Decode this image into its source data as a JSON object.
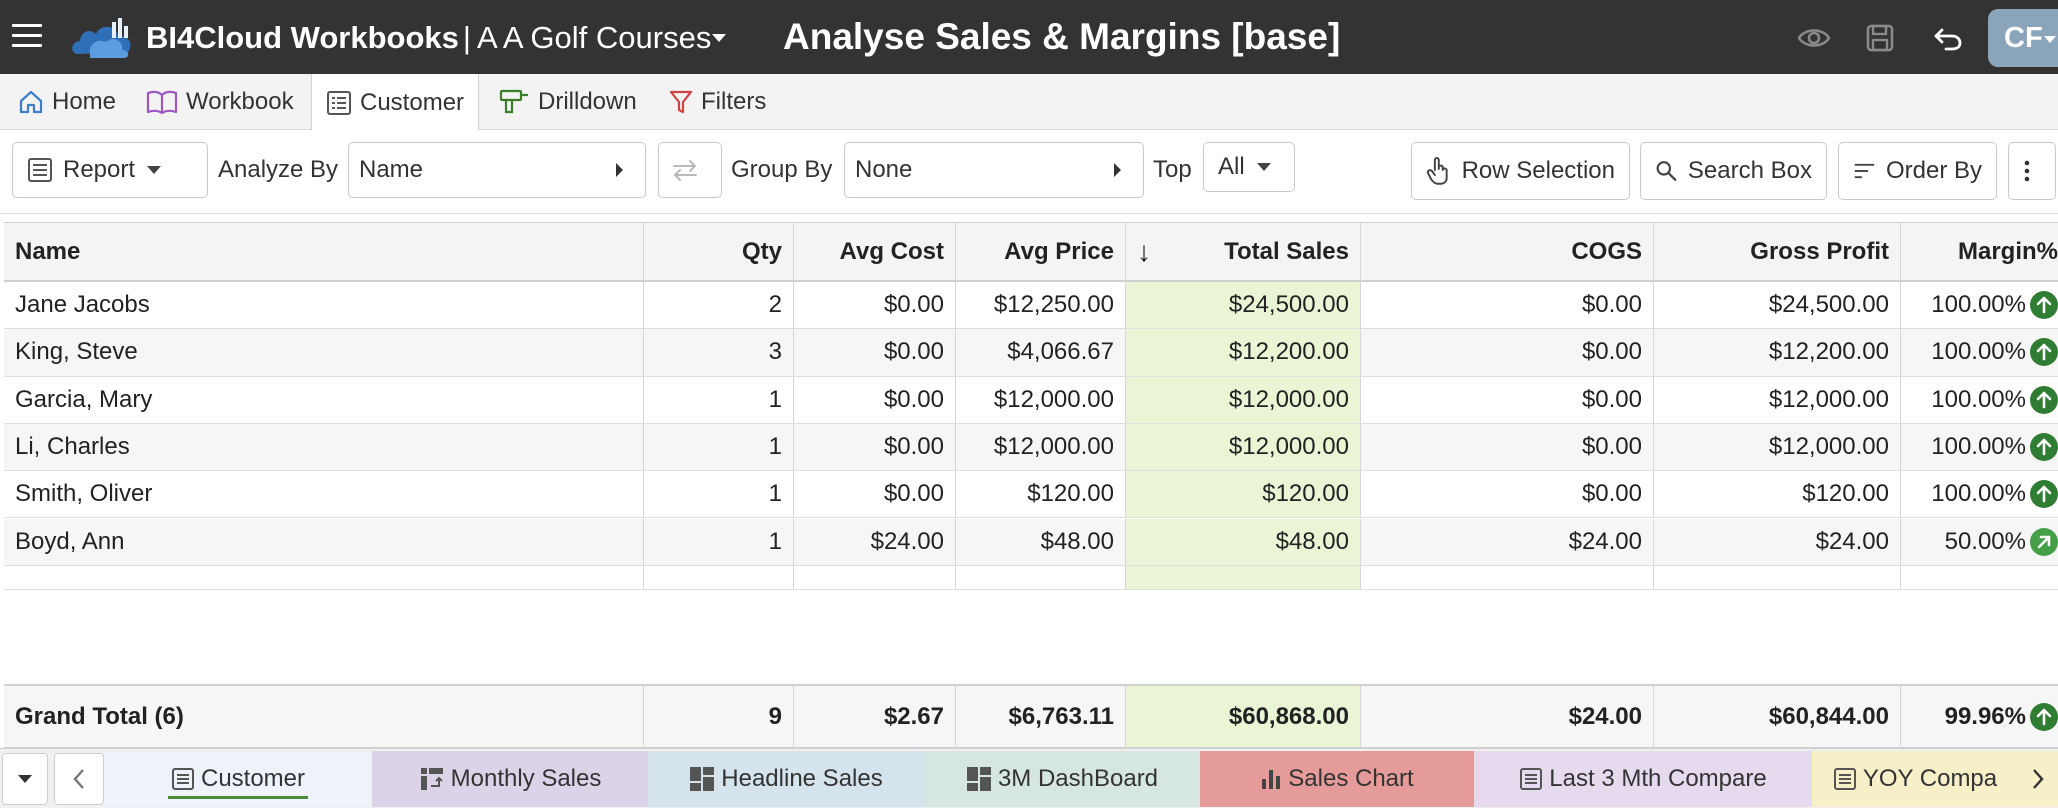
{
  "app": {
    "brand": "BI4Cloud Workbooks",
    "separator": "|",
    "company": "A A Golf Courses",
    "page_title": "Analyse Sales & Margins [base]",
    "user_initials": "CF"
  },
  "nav_tabs": [
    {
      "label": "Home",
      "icon": "home-icon"
    },
    {
      "label": "Workbook",
      "icon": "book-icon"
    },
    {
      "label": "Customer",
      "icon": "list-icon",
      "active": true
    },
    {
      "label": "Drilldown",
      "icon": "drill-icon"
    },
    {
      "label": "Filters",
      "icon": "filter-icon"
    }
  ],
  "toolbar": {
    "report_label": "Report",
    "analyze_by_label": "Analyze By",
    "analyze_by_value": "Name",
    "group_by_label": "Group By",
    "group_by_value": "None",
    "top_label": "Top",
    "top_value": "All",
    "row_selection_label": "Row Selection",
    "search_box_label": "Search Box",
    "order_by_label": "Order By"
  },
  "table": {
    "columns": [
      "Name",
      "Qty",
      "Avg Cost",
      "Avg Price",
      "Total Sales",
      "COGS",
      "Gross Profit",
      "Margin%"
    ],
    "sort_indicator": "↓",
    "rows": [
      {
        "name": "Jane Jacobs",
        "qty": "2",
        "avg_cost": "$0.00",
        "avg_price": "$12,250.00",
        "total_sales": "$24,500.00",
        "cogs": "$0.00",
        "gross_profit": "$24,500.00",
        "margin": "100.00%",
        "trend": "up"
      },
      {
        "name": "King, Steve",
        "qty": "3",
        "avg_cost": "$0.00",
        "avg_price": "$4,066.67",
        "total_sales": "$12,200.00",
        "cogs": "$0.00",
        "gross_profit": "$12,200.00",
        "margin": "100.00%",
        "trend": "up"
      },
      {
        "name": "Garcia, Mary",
        "qty": "1",
        "avg_cost": "$0.00",
        "avg_price": "$12,000.00",
        "total_sales": "$12,000.00",
        "cogs": "$0.00",
        "gross_profit": "$12,000.00",
        "margin": "100.00%",
        "trend": "up"
      },
      {
        "name": "Li, Charles",
        "qty": "1",
        "avg_cost": "$0.00",
        "avg_price": "$12,000.00",
        "total_sales": "$12,000.00",
        "cogs": "$0.00",
        "gross_profit": "$12,000.00",
        "margin": "100.00%",
        "trend": "up"
      },
      {
        "name": "Smith, Oliver",
        "qty": "1",
        "avg_cost": "$0.00",
        "avg_price": "$120.00",
        "total_sales": "$120.00",
        "cogs": "$0.00",
        "gross_profit": "$120.00",
        "margin": "100.00%",
        "trend": "up"
      },
      {
        "name": "Boyd, Ann",
        "qty": "1",
        "avg_cost": "$24.00",
        "avg_price": "$48.00",
        "total_sales": "$48.00",
        "cogs": "$24.00",
        "gross_profit": "$24.00",
        "margin": "50.00%",
        "trend": "up-right"
      }
    ],
    "total": {
      "name": "Grand Total (6)",
      "qty": "9",
      "avg_cost": "$2.67",
      "avg_price": "$6,763.11",
      "total_sales": "$60,868.00",
      "cogs": "$24.00",
      "gross_profit": "$60,844.00",
      "margin": "99.96%",
      "trend": "up"
    }
  },
  "bottom_tabs": [
    {
      "label": "Customer",
      "bg": "#eef3fb",
      "active": true,
      "icon": "list-icon"
    },
    {
      "label": "Monthly Sales",
      "bg": "#dcd3e8",
      "icon": "pivot-icon"
    },
    {
      "label": "Headline Sales",
      "bg": "#d5e4ec",
      "icon": "dashboard-icon"
    },
    {
      "label": "3M DashBoard",
      "bg": "#d6e7e2",
      "icon": "dashboard-icon"
    },
    {
      "label": "Sales Chart",
      "bg": "#e59b99",
      "icon": "bar-chart-icon"
    },
    {
      "label": "Last 3 Mth Compare",
      "bg": "#e6daef",
      "icon": "list-icon"
    },
    {
      "label": "YOY Compa",
      "bg": "#f6efc8",
      "icon": "list-icon"
    }
  ],
  "colors": {
    "titlebar": "#333333",
    "sales_highlight": "#eaf5d6",
    "trend_up": "#2e7d32",
    "trend_up_right": "#43a047"
  }
}
